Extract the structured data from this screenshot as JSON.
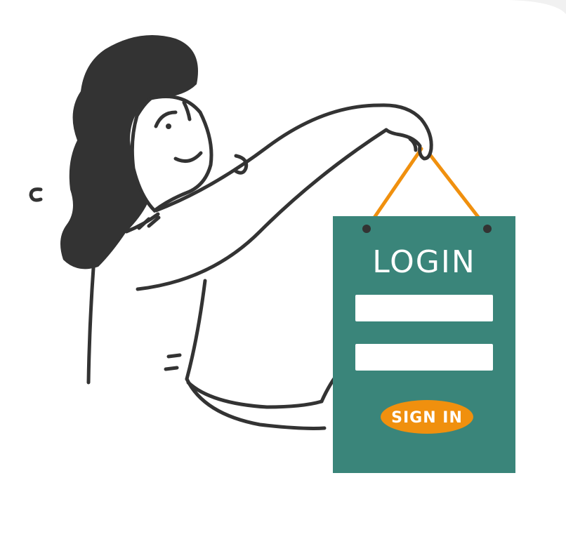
{
  "sign": {
    "title": "LOGIN",
    "button_label": "SIGN IN"
  },
  "colors": {
    "sign_board": "#3a857a",
    "button": "#f0900e",
    "strings": "#f0900e",
    "hair": "#333333",
    "outline": "#333333",
    "field": "#ffffff"
  }
}
